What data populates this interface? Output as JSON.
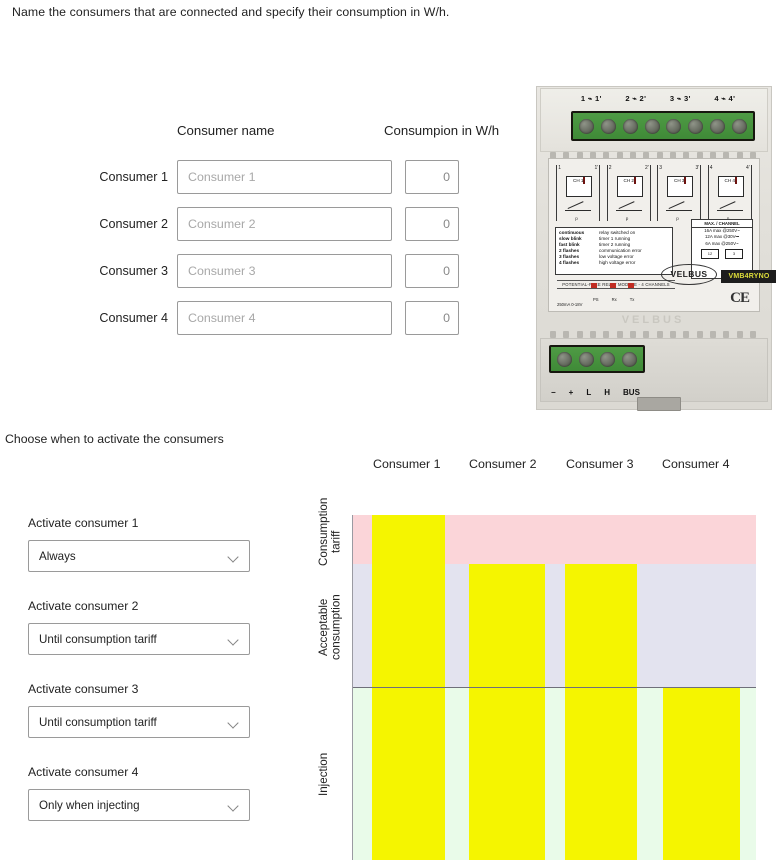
{
  "instruction": "Name the consumers that are connected and specify their consumption in W/h.",
  "form": {
    "header_name": "Consumer name",
    "header_consumption": "Consumpion in W/h",
    "rows": [
      {
        "label": "Consumer 1",
        "name_placeholder": "Consumer 1",
        "name_value": "",
        "consumption_value": "0"
      },
      {
        "label": "Consumer 2",
        "name_placeholder": "Consumer 2",
        "name_value": "",
        "consumption_value": "0"
      },
      {
        "label": "Consumer 3",
        "name_placeholder": "Consumer 3",
        "name_value": "",
        "consumption_value": "0"
      },
      {
        "label": "Consumer 4",
        "name_placeholder": "Consumer 4",
        "name_value": "",
        "consumption_value": "0"
      }
    ]
  },
  "device": {
    "brand": "VELBUS",
    "brand_oval": "VELBUS",
    "part_number": "VMB4RYNO",
    "module_description": "POTENTIAL-FREE RELAY MODULE - 4 CHANNELS",
    "ce_mark": "CE",
    "top_terminal_labels": [
      "1 ⌁ 1'",
      "2 ⌁ 2'",
      "3 ⌁ 3'",
      "4 ⌁ 4'"
    ],
    "channels": [
      {
        "left": "1",
        "right": "1'",
        "box": "CH 1",
        "foot": "p"
      },
      {
        "left": "2",
        "right": "2'",
        "box": "CH 2",
        "foot": "p"
      },
      {
        "left": "3",
        "right": "3'",
        "box": "CH 3",
        "foot": "p"
      },
      {
        "left": "4",
        "right": "4'",
        "box": "CH 4",
        "foot": "p"
      }
    ],
    "legend": [
      {
        "key": "continuous",
        "text": "relay switched on"
      },
      {
        "key": "slow blink",
        "text": "timer 1 running"
      },
      {
        "key": "fast blink",
        "text": "timer 2 running"
      },
      {
        "key": "2 flashes",
        "text": "communication error"
      },
      {
        "key": "3 flashes",
        "text": "low voltage error"
      },
      {
        "key": "4 flashes",
        "text": "high voltage error"
      }
    ],
    "spec": {
      "title": "MAX. / CHANNEL",
      "lines": [
        "16A max @250V~",
        "12A max @30V⎓",
        "6A max @250V~"
      ],
      "symbols": [
        "12",
        "3"
      ]
    },
    "voltage_note": "250mA\n0-18V",
    "led_labels": [
      "PS",
      "Rx",
      "Tx"
    ],
    "bus_terminal_labels": [
      "−",
      "+",
      "L",
      "H",
      "BUS"
    ]
  },
  "activation": {
    "section_title": "Choose when to activate the consumers",
    "controls": [
      {
        "label": "Activate consumer 1",
        "value": "Always"
      },
      {
        "label": "Activate consumer 2",
        "value": "Until consumption tariff"
      },
      {
        "label": "Activate consumer 3",
        "value": "Until consumption tariff"
      },
      {
        "label": "Activate consumer 4",
        "value": "Only when injecting"
      }
    ]
  },
  "chart_data": {
    "type": "bar",
    "title": "",
    "xlabel": "",
    "ylabel": "",
    "grid": false,
    "legend_position": "none",
    "categories": [
      "Consumer 1",
      "Consumer 2",
      "Consumer 3",
      "Consumer 4"
    ],
    "values": [
      3,
      2,
      2,
      1
    ],
    "value_labels": [
      "Consumption tariff",
      "Acceptable consumption",
      "Acceptable consumption",
      "Injection"
    ],
    "ylim": [
      0,
      3
    ],
    "y_band_labels": [
      "Consumption tariff",
      "Acceptable consumption",
      "Injection"
    ],
    "y_bands": [
      {
        "label": "Consumption tariff",
        "color": "#fbd5d9",
        "top_pct": 0,
        "height_pct": 14.2
      },
      {
        "label": "Acceptable consumption",
        "color": "#e3e3ef",
        "top_pct": 14.2,
        "height_pct": 35.6
      },
      {
        "label": "Injection",
        "color": "#e9fbe9",
        "top_pct": 49.8,
        "height_pct": 50.2
      }
    ],
    "bar_color": "#f5f500",
    "axis_color": "#9a9aa2",
    "bars": [
      {
        "category": "Consumer 1",
        "left_pct": 5.0,
        "width_pct": 18.1,
        "top_pct": 0.0
      },
      {
        "category": "Consumer 2",
        "left_pct": 29.0,
        "width_pct": 18.8,
        "top_pct": 14.2
      },
      {
        "category": "Consumer 3",
        "left_pct": 52.7,
        "width_pct": 17.8,
        "top_pct": 14.2
      },
      {
        "category": "Consumer 4",
        "left_pct": 77.0,
        "width_pct": 19.0,
        "top_pct": 49.8
      }
    ]
  }
}
